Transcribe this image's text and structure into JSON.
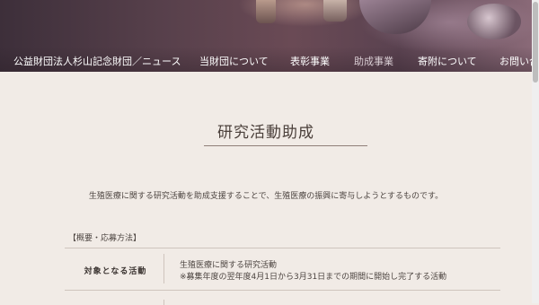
{
  "header": {
    "nav": [
      {
        "label": "公益財団法人杉山記念財団／ニュース",
        "muted": false
      },
      {
        "label": "当財団について",
        "muted": false
      },
      {
        "label": "表彰事業",
        "muted": false
      },
      {
        "label": "助成事業",
        "muted": true
      },
      {
        "label": "寄附について",
        "muted": false
      },
      {
        "label": "お問い合",
        "muted": false
      }
    ]
  },
  "main": {
    "title": "研究活動助成",
    "intro": "生殖医療に関する研究活動を助成支援することで、生殖医療の振興に寄与しようとするものです。",
    "section_label": "【概要・応募方法】",
    "rows": [
      {
        "label": "対象となる活動",
        "lines": [
          "生殖医療に関する研究活動",
          "※募集年度の翌年度4月1日から3月31日までの期間に開始し完了する活動"
        ]
      }
    ]
  }
}
